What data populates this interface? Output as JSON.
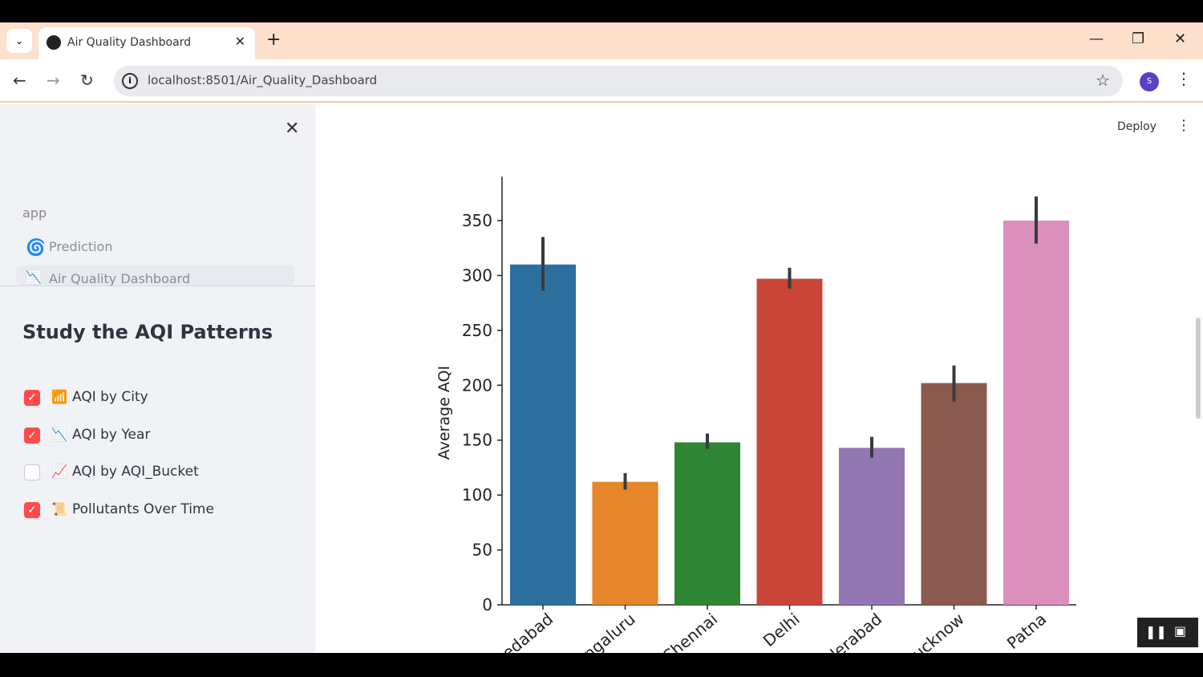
{
  "browser": {
    "tab_title": "Air Quality Dashboard",
    "url": "localhost:8501/Air_Quality_Dashboard",
    "profile_initial": "S"
  },
  "sidebar": {
    "app_label": "app",
    "nav": [
      {
        "label": "Prediction",
        "icon": "spiral-icon"
      },
      {
        "label": "Air Quality Dashboard",
        "icon": "chart-down-icon",
        "active": true
      }
    ],
    "heading": "Study the AQI Patterns",
    "options": [
      {
        "label": "AQI by City",
        "checked": true,
        "icon": "bar-chart-icon"
      },
      {
        "label": "AQI by Year",
        "checked": true,
        "icon": "chart-decreasing-icon"
      },
      {
        "label": "AQI by AQI_Bucket",
        "checked": false,
        "icon": "chart-increasing-icon"
      },
      {
        "label": "Pollutants Over Time",
        "checked": true,
        "icon": "scroll-icon"
      }
    ]
  },
  "main": {
    "deploy_label": "Deploy"
  },
  "chart_data": {
    "type": "bar",
    "title": "",
    "xlabel": "",
    "ylabel": "Average AQI",
    "ylim": [
      0,
      390
    ],
    "yticks": [
      0,
      50,
      100,
      150,
      200,
      250,
      300,
      350
    ],
    "categories": [
      "Ahmedabad",
      "Bengaluru",
      "Chennai",
      "Delhi",
      "Hyderabad",
      "Lucknow",
      "Patna"
    ],
    "values": [
      310,
      112,
      148,
      297,
      143,
      202,
      350
    ],
    "error_low": [
      286,
      105,
      142,
      288,
      134,
      185,
      329
    ],
    "error_high": [
      335,
      120,
      156,
      307,
      153,
      218,
      372
    ],
    "colors": [
      "#2c6f9f",
      "#e6852a",
      "#2e8533",
      "#c84537",
      "#9377b3",
      "#8a5a4e",
      "#db8fbc"
    ],
    "grid": false
  }
}
